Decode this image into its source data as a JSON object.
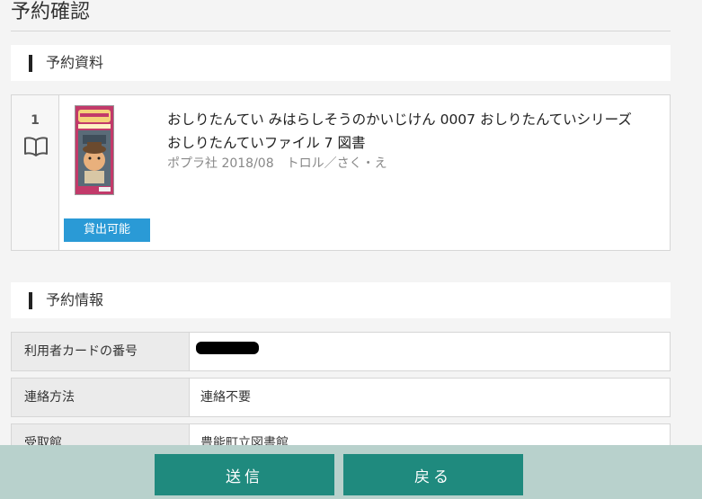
{
  "page": {
    "title": "予約確認"
  },
  "sections": {
    "materials": "予約資料",
    "info": "予約情報"
  },
  "book": {
    "index": "1",
    "title": "おしりたんてい みはらしそうのかいじけん 0007 おしりたんていシリーズ　おしりたんていファイル 7 図書",
    "meta": "ポプラ社 2018/08　トロル／さく・え",
    "status": "貸出可能",
    "cover_colors": {
      "frame": "#c23a6a",
      "title": "#f5d27a",
      "sky": "#5a6b78",
      "face": "#e9b07c"
    }
  },
  "info_rows": [
    {
      "label": "利用者カードの番号",
      "value": ""
    },
    {
      "label": "連絡方法",
      "value": "連絡不要"
    },
    {
      "label": "受取館",
      "value": "豊能町立図書館"
    }
  ],
  "buttons": {
    "submit": "送信",
    "back": "戻る"
  },
  "colors": {
    "accent": "#2a9ad6",
    "primary_button": "#1f8a7e",
    "footer": "#b8d1cc"
  },
  "icons": {
    "book": "open-book-icon"
  }
}
